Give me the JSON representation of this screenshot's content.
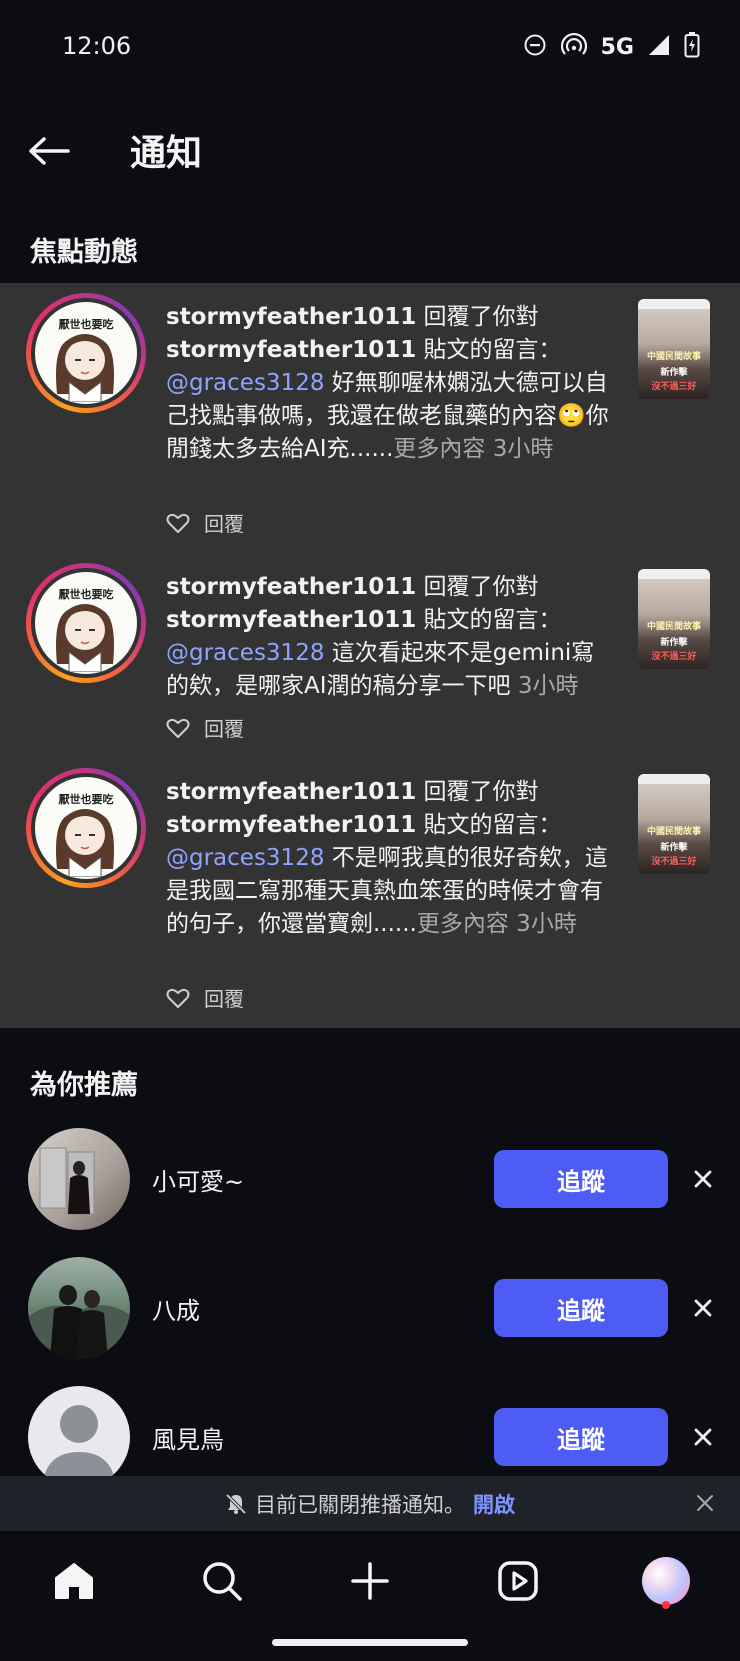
{
  "status_bar": {
    "time": "12:06",
    "network": "5G",
    "icons": [
      "do-not-disturb-icon",
      "hotspot-icon",
      "signal-icon",
      "battery-charging-icon"
    ]
  },
  "header": {
    "title": "通知",
    "back_icon": "arrow-left-icon"
  },
  "focus_section": {
    "title": "焦點動態",
    "notifications": [
      {
        "avatar_caption": "厭世也要吃",
        "user1": "stormyfeather1011",
        "action1": " 回覆了你對",
        "user2": "stormyfeather1011",
        "action2": " 貼文的留言：",
        "mention": "@graces3128",
        "text": " 好無聊喔林嫻泓大德可以自己找點事做嗎，我還在做老鼠藥的內容🙄你閒錢太多去給AI充......",
        "more": "更多內容",
        "time": " 3小時",
        "reply_label": "回覆",
        "thumb_lines": [
          "中國民間故事",
          "新作擊",
          "沒不過三好"
        ]
      },
      {
        "avatar_caption": "厭世也要吃",
        "user1": "stormyfeather1011",
        "action1": " 回覆了你對",
        "user2": "stormyfeather1011",
        "action2": " 貼文的留言：",
        "mention": "@graces3128",
        "text": " 這次看起來不是gemini寫的欸，是哪家AI潤的稿分享一下吧",
        "more": "",
        "time": " 3小時",
        "reply_label": "回覆",
        "thumb_lines": [
          "中國民間故事",
          "新作擊",
          "沒不過三好"
        ]
      },
      {
        "avatar_caption": "厭世也要吃",
        "user1": "stormyfeather1011",
        "action1": " 回覆了你對",
        "user2": "stormyfeather1011",
        "action2": " 貼文的留言：",
        "mention": "@graces3128",
        "text": " 不是啊我真的很好奇欸，這是我國二寫那種天真熱血笨蛋的時候才會有的句子，你還當寶劍......",
        "more": "更多內容",
        "time": " 3小時",
        "reply_label": "回覆",
        "thumb_lines": [
          "中國民間故事",
          "新作擊",
          "沒不過三好"
        ]
      }
    ]
  },
  "suggest_section": {
    "title": "為你推薦",
    "items": [
      {
        "name": "小可愛~",
        "follow_label": "追蹤"
      },
      {
        "name": "八成",
        "follow_label": "追蹤"
      },
      {
        "name": "風見鳥",
        "follow_label": "追蹤"
      }
    ]
  },
  "push_banner": {
    "text": "目前已關閉推播通知。",
    "enable_label": "開啟"
  },
  "bottom_nav": {
    "items": [
      "home-icon",
      "search-icon",
      "create-icon",
      "reels-icon",
      "profile-avatar"
    ]
  },
  "colors": {
    "background": "#0b0d12",
    "panel": "#333333",
    "accent": "#4d5cf5",
    "mention": "#8fa3ff"
  }
}
